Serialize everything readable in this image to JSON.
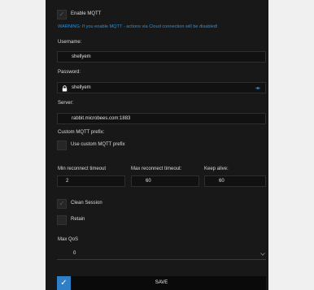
{
  "mqtt": {
    "enable_label": "Enable MQTT",
    "enabled": true,
    "warning": "WARNING: If you enable MQTT - actions via Cloud connection will be disabled!",
    "username_label": "Username:",
    "username_value": "shellyem",
    "password_label": "Password:",
    "password_value": "shellyem",
    "server_label": "Server:",
    "server_value": "rabbit.microbees.com:1883",
    "prefix_label": "Custom MQTT prefix:",
    "use_prefix_label": "Use custom MQTT prefix",
    "use_prefix_checked": false,
    "min_reconnect_label": "Min reconnect timeout",
    "min_reconnect_value": "2",
    "max_reconnect_label": "Max reconnect timeout:",
    "max_reconnect_value": "60",
    "keep_alive_label": "Keep alive:",
    "keep_alive_value": "60",
    "clean_session_label": "Clean Session",
    "clean_session_checked": true,
    "retain_label": "Retain",
    "retain_checked": false,
    "max_qos_label": "Max QoS",
    "max_qos_value": "0",
    "save_label": "SAVE"
  },
  "colors": {
    "panel": "#181818",
    "accent": "#2f8fd6",
    "save_accent": "#2f7fc7",
    "page_bg": "#f0f0f0"
  },
  "icons": [
    "check-icon",
    "lock-icon",
    "eye-icon",
    "chevron-down-icon"
  ]
}
